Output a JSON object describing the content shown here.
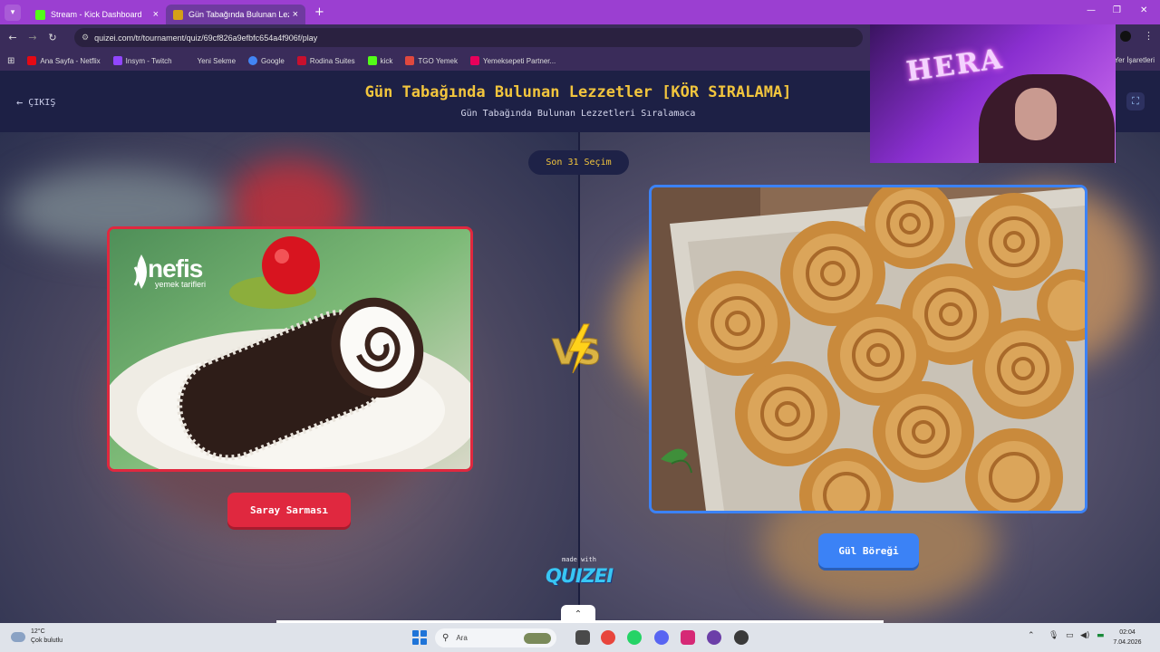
{
  "browser": {
    "tabs": [
      {
        "title": "Stream - Kick Dashboard",
        "favicon_color": "#53fc18"
      },
      {
        "title": "Gün Tabağında Bulunan Lezzetl",
        "favicon_color": "#d4a017"
      }
    ],
    "url": "quizei.com/tr/tournament/quiz/69cf826a9efbfc654a4f906f/play",
    "bookmarks": [
      {
        "label": "Ana Sayfa - Netflix",
        "color": "#e50914"
      },
      {
        "label": "Insym - Twitch",
        "color": "#9146ff"
      },
      {
        "label": "Yeni Sekme",
        "color": "#cccccc"
      },
      {
        "label": "Google",
        "color": "#4285f4"
      },
      {
        "label": "Rodina Suites",
        "color": "#c8102e"
      },
      {
        "label": "kick",
        "color": "#53fc18"
      },
      {
        "label": "TGO Yemek",
        "color": "#e0483e"
      },
      {
        "label": "Yemeksepeti Partner...",
        "color": "#e9005b"
      }
    ],
    "bookmarks_right": "Yer İşaretleri"
  },
  "header": {
    "exit_label": "ÇIKIŞ",
    "title": "Gün Tabağında Bulunan Lezzetler [KÖR SIRALAMA]",
    "subtitle": "Gün Tabağında Bulunan Lezzetleri Sıralamaca"
  },
  "game": {
    "choices_left_label": "Son 31 Seçim",
    "left_option": {
      "name": "Saray Sarması",
      "image_watermark_brand": "nefis",
      "image_watermark_sub": "yemek tarifleri",
      "accent": "#e0283f"
    },
    "right_option": {
      "name": "Gül Böreği",
      "accent": "#3b82f6"
    },
    "vs_label": "VS"
  },
  "footer": {
    "made_with": "made with",
    "brand": "QUIZEI"
  },
  "webcam": {
    "overlay_text": "HERA"
  },
  "taskbar": {
    "weather_temp": "12°C",
    "weather_desc": "Çok bulutlu",
    "search_placeholder": "Ara",
    "time": "02:04",
    "date": "7.04.2026"
  }
}
